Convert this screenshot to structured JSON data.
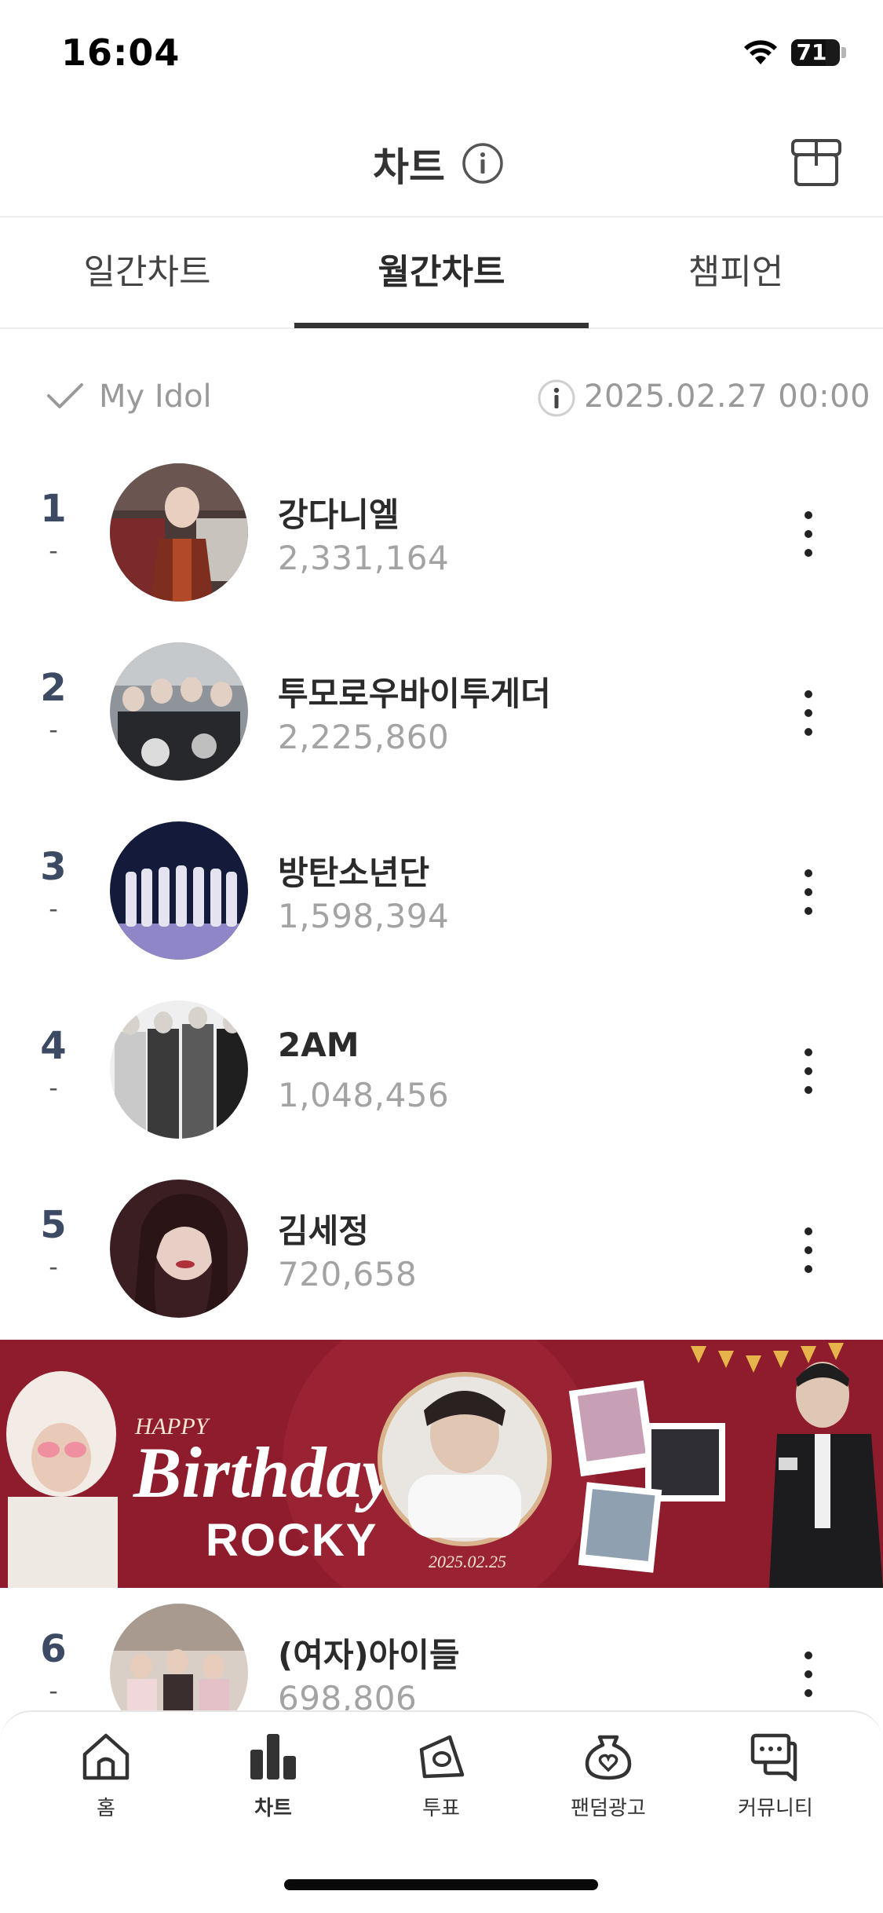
{
  "status_bar": {
    "time": "16:04",
    "battery": "71"
  },
  "header": {
    "title": "차트"
  },
  "tabs": [
    {
      "label": "일간차트",
      "active": false
    },
    {
      "label": "월간차트",
      "active": true
    },
    {
      "label": "챔피언",
      "active": false
    }
  ],
  "filter": {
    "my_idol_label": "My Idol",
    "updated_at": "2025.02.27 00:00"
  },
  "ranking": [
    {
      "rank": "1",
      "change": "-",
      "name": "강다니엘",
      "votes": "2,331,164"
    },
    {
      "rank": "2",
      "change": "-",
      "name": "투모로우바이투게더",
      "votes": "2,225,860"
    },
    {
      "rank": "3",
      "change": "-",
      "name": "방탄소년단",
      "votes": "1,598,394"
    },
    {
      "rank": "4",
      "change": "-",
      "name": "2AM",
      "votes": "1,048,456"
    },
    {
      "rank": "5",
      "change": "-",
      "name": "김세정",
      "votes": "720,658"
    },
    {
      "rank": "6",
      "change": "-",
      "name": "(여자)아이들",
      "votes": "698,806"
    }
  ],
  "banner": {
    "happy": "HAPPY",
    "birthday": "Birthday",
    "name": "ROCKY",
    "date": "2025.02.25"
  },
  "bottom_nav": [
    {
      "label": "홈",
      "icon": "home-icon",
      "active": false
    },
    {
      "label": "차트",
      "icon": "chart-icon",
      "active": true
    },
    {
      "label": "투표",
      "icon": "vote-icon",
      "active": false
    },
    {
      "label": "팬덤광고",
      "icon": "fandom-ad-icon",
      "active": false
    },
    {
      "label": "커뮤니티",
      "icon": "community-icon",
      "active": false
    }
  ],
  "colors": {
    "accent": "#333333",
    "rank_num": "#3d4a63",
    "muted": "#a3a3a3",
    "banner_bg": "#8f1c2c"
  }
}
